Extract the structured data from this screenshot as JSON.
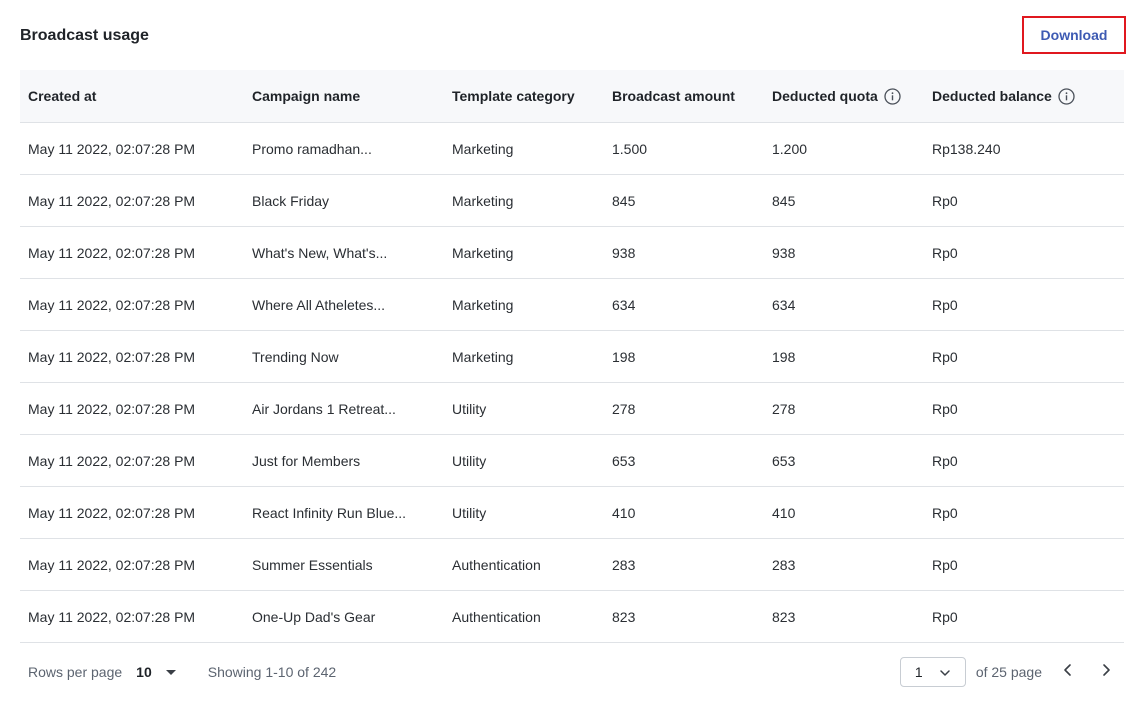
{
  "page": {
    "title": "Broadcast usage",
    "download_label": "Download"
  },
  "colors": {
    "accent": "#3d5ab3",
    "highlight_border": "#e0181f",
    "header_bg": "#f7f8fa",
    "divider": "#dfe2e6"
  },
  "table": {
    "columns": [
      {
        "label": "Created at",
        "info": false
      },
      {
        "label": "Campaign name",
        "info": false
      },
      {
        "label": "Template category",
        "info": false
      },
      {
        "label": "Broadcast amount",
        "info": false
      },
      {
        "label": "Deducted quota",
        "info": true,
        "icon": "info-icon"
      },
      {
        "label": "Deducted balance",
        "info": true,
        "icon": "info-icon"
      }
    ],
    "rows": [
      [
        "May 11 2022, 02:07:28 PM",
        "Promo ramadhan...",
        "Marketing",
        "1.500",
        "1.200",
        "Rp138.240"
      ],
      [
        "May 11 2022, 02:07:28 PM",
        "Black Friday",
        "Marketing",
        "845",
        "845",
        "Rp0"
      ],
      [
        "May 11 2022, 02:07:28 PM",
        "What's New, What's...",
        "Marketing",
        "938",
        "938",
        "Rp0"
      ],
      [
        "May 11 2022, 02:07:28 PM",
        "Where All Atheletes...",
        "Marketing",
        "634",
        "634",
        "Rp0"
      ],
      [
        "May 11 2022, 02:07:28 PM",
        "Trending Now",
        "Marketing",
        "198",
        "198",
        "Rp0"
      ],
      [
        "May 11 2022, 02:07:28 PM",
        "Air Jordans 1 Retreat...",
        "Utility",
        "278",
        "278",
        "Rp0"
      ],
      [
        "May 11 2022, 02:07:28 PM",
        "Just for Members",
        "Utility",
        "653",
        "653",
        "Rp0"
      ],
      [
        "May 11 2022, 02:07:28 PM",
        "React Infinity Run Blue...",
        "Utility",
        "410",
        "410",
        "Rp0"
      ],
      [
        "May 11 2022, 02:07:28 PM",
        "Summer Essentials",
        "Authentication",
        "283",
        "283",
        "Rp0"
      ],
      [
        "May 11 2022, 02:07:28 PM",
        "One-Up Dad's Gear",
        "Authentication",
        "823",
        "823",
        "Rp0"
      ]
    ]
  },
  "footer": {
    "rows_per_page_label": "Rows per page",
    "rows_per_page_value": "10",
    "showing_text": "Showing 1-10 of 242",
    "current_page": "1",
    "of_pages_text": "of 25 page",
    "icons": {
      "rows_dropdown": "caret-down-icon",
      "page_dropdown": "chevron-down-icon",
      "prev": "chevron-left-icon",
      "next": "chevron-right-icon"
    }
  }
}
